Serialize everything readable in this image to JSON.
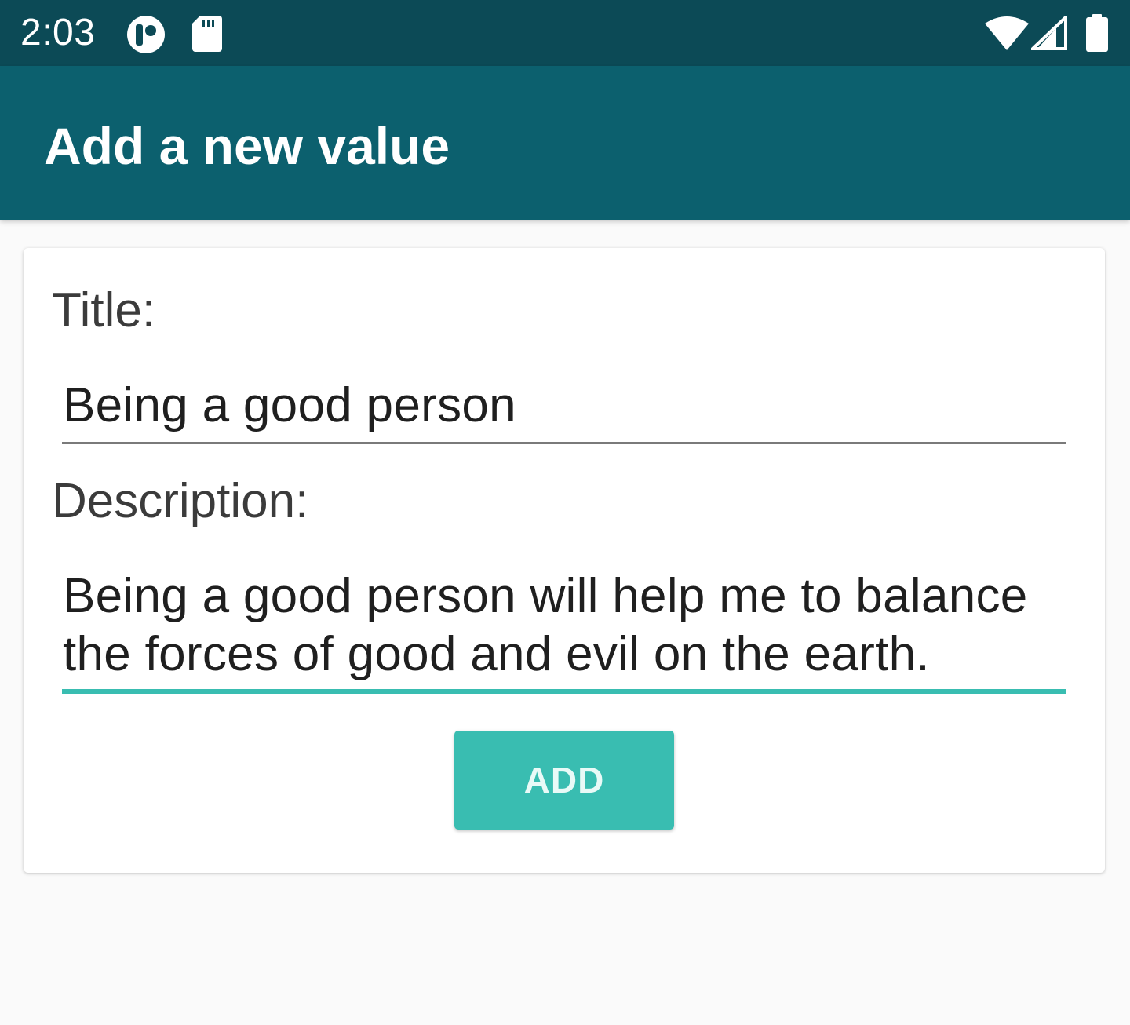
{
  "status_bar": {
    "time": "2:03",
    "icons": [
      "pocket-casts-icon",
      "sd-card-icon",
      "wifi-icon",
      "cell-signal-icon",
      "battery-icon"
    ]
  },
  "app_bar": {
    "title": "Add a new value"
  },
  "form": {
    "title_label": "Title:",
    "title_value": "Being a good person",
    "description_label": "Description:",
    "description_value": "Being a good person will help me to balance the forces of good and evil on the earth.",
    "add_button_label": "ADD"
  },
  "colors": {
    "status_bar": "#0c4a56",
    "app_bar": "#0c606e",
    "accent": "#39bdb1",
    "background": "#fafafa"
  }
}
